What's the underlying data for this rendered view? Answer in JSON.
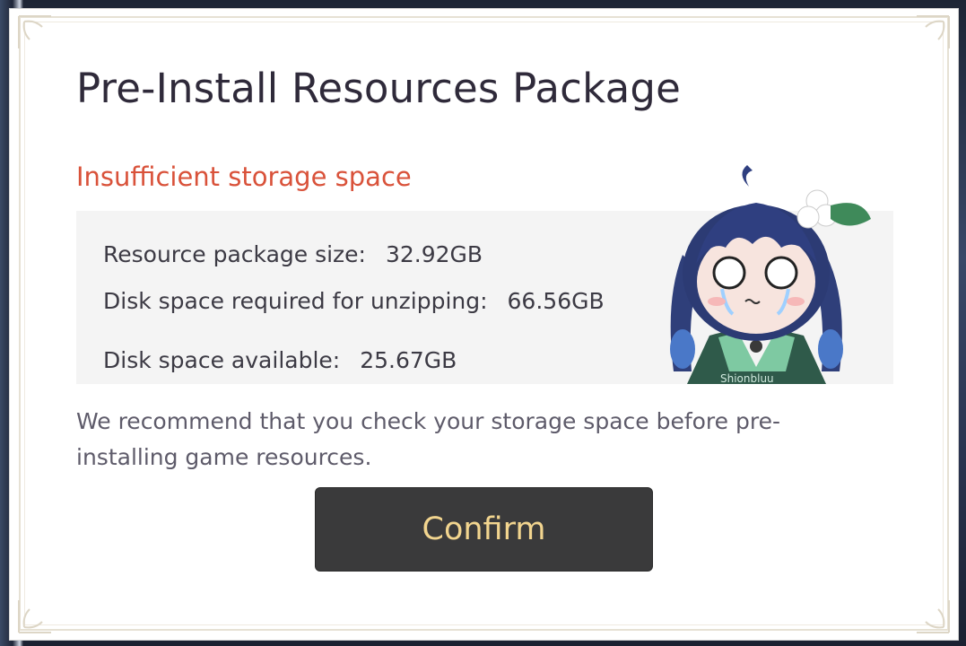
{
  "dialog": {
    "title": "Pre-Install Resources Package",
    "warning": "Insufficient storage space",
    "info": [
      {
        "label": "Resource package size:",
        "value": "32.92GB"
      },
      {
        "label": "Disk space required for unzipping:",
        "value": "66.56GB"
      },
      {
        "label": "Disk space available:",
        "value": "25.67GB"
      }
    ],
    "recommendation": "We recommend that you check your storage space before pre-installing game resources.",
    "confirm_label": "Confirm",
    "mascot_watermark": "Shionbluu"
  },
  "colors": {
    "warning": "#d9523a",
    "button_bg": "#3a3a3b",
    "button_text": "#f2d58f",
    "info_bg": "#f4f4f4"
  }
}
